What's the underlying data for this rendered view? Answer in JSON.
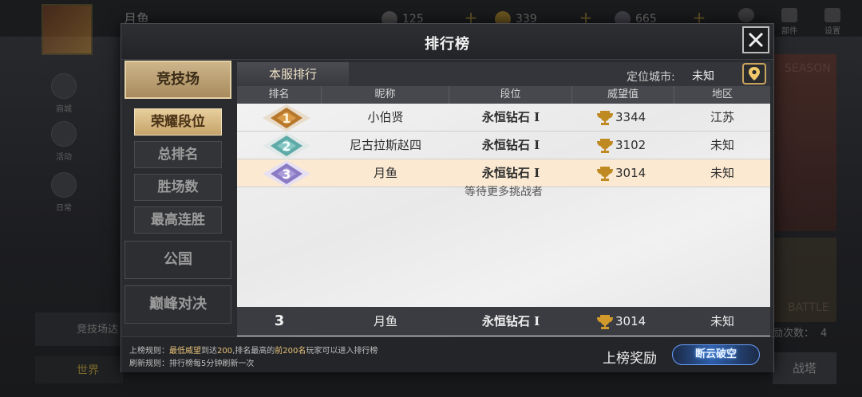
{
  "background": {
    "player_name": "月鱼",
    "resources": [
      "125",
      "339",
      "665"
    ],
    "badge_count": "1",
    "top_icons": [
      "部件",
      "设置"
    ],
    "side_icons": [
      "商城",
      "活动",
      "日常"
    ],
    "bottom_left": "竞技场达",
    "chat_channel": "世界",
    "challenge_label": "励次数：",
    "challenge_count": "4",
    "battle_button": "战塔",
    "season_text": "SEASON",
    "battle_text": "BATTLE"
  },
  "modal": {
    "title": "排行榜",
    "close_icon": "close-icon"
  },
  "side": {
    "main_tabs": [
      "竞技场",
      "公国",
      "巅峰对决"
    ],
    "sub_tabs": [
      "荣耀段位",
      "总排名",
      "胜场数",
      "最高连胜"
    ],
    "active_main": 0,
    "active_sub": 0
  },
  "panel": {
    "server_tab": "本服排行",
    "city_label": "定位城市:",
    "city_value": "未知",
    "locate_icon": "location-pin-icon",
    "columns": [
      "排名",
      "昵称",
      "段位",
      "威望值",
      "地区"
    ],
    "rows": [
      {
        "rank": "1",
        "name": "小伯贤",
        "tier": "永恒钻石 I",
        "prestige": "3344",
        "region": "江苏"
      },
      {
        "rank": "2",
        "name": "尼古拉斯赵四",
        "tier": "永恒钻石 I",
        "prestige": "3102",
        "region": "未知"
      },
      {
        "rank": "3",
        "name": "月鱼",
        "tier": "永恒钻石 I",
        "prestige": "3014",
        "region": "未知"
      }
    ],
    "waiting_text": "等待更多挑战者",
    "self": {
      "rank": "3",
      "name": "月鱼",
      "tier": "永恒钻石 I",
      "prestige": "3014",
      "region": "未知"
    }
  },
  "footer": {
    "rule1_prefix": "上榜规则：",
    "rule1_a": "最低威望",
    "rule1_b": "到达",
    "rule1_c": "200",
    "rule1_d": ",排名最高的",
    "rule1_e": "前200名",
    "rule1_f": "玩家可以进入排行榜",
    "rule2": "刷新规则：排行榜每5分钟刷新一次",
    "reward_label": "上榜奖励",
    "reward_button": "断云破空"
  },
  "colors": {
    "gold": "#c9a45e",
    "rank1": "#b7782c",
    "rank2": "#5eaaa8",
    "rank3": "#8a7bc4"
  }
}
